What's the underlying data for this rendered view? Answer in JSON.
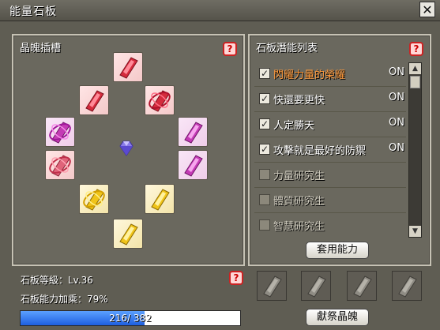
{
  "window": {
    "title": "能量石板",
    "close_label": "✕"
  },
  "crystal_panel": {
    "title": "晶魄插槽",
    "help_label": "?",
    "slots": [
      {
        "color": "red",
        "icon": "crystal-icon"
      },
      {
        "color": "red",
        "icon": "crystal-icon"
      },
      {
        "color": "red",
        "icon": "crystal-ring-icon"
      },
      {
        "color": "pink",
        "icon": "crystal-ring-icon"
      },
      {
        "color": "pink",
        "icon": "crystal-icon"
      },
      {
        "color": "red",
        "icon": "crystal-ring-icon"
      },
      {
        "color": "pink",
        "icon": "crystal-icon"
      },
      {
        "color": "yellow",
        "icon": "crystal-ring-icon"
      },
      {
        "color": "yellow",
        "icon": "crystal-icon"
      },
      {
        "color": "yellow",
        "icon": "crystal-icon"
      }
    ],
    "center_icon": "diamond-icon"
  },
  "ability_panel": {
    "title": "石板潛能列表",
    "help_label": "?",
    "items": [
      {
        "label": "閃耀力量的榮耀",
        "checked": true,
        "status": "ON",
        "highlight": true
      },
      {
        "label": "快還要更快",
        "checked": true,
        "status": "ON"
      },
      {
        "label": "人定勝天",
        "checked": true,
        "status": "ON"
      },
      {
        "label": "攻擊就是最好的防禦",
        "checked": true,
        "status": "ON"
      },
      {
        "label": "力量研究生",
        "checked": false,
        "status": ""
      },
      {
        "label": "體質研究生",
        "checked": false,
        "status": ""
      },
      {
        "label": "智慧研究生",
        "checked": false,
        "status": ""
      }
    ],
    "scroll_up": "▲",
    "scroll_down": "▼",
    "apply_button": "套用能力"
  },
  "stats": {
    "level_text": "石板等級：Lv.36",
    "bonus_text": "石板能力加乘：79%",
    "help_label": "?",
    "progress": {
      "current": 216,
      "max": 382,
      "text": "216/ 382"
    }
  },
  "offer_slots": [
    {
      "icon": "empty-crystal-icon"
    },
    {
      "icon": "empty-crystal-icon"
    },
    {
      "icon": "empty-crystal-icon"
    },
    {
      "icon": "empty-crystal-icon"
    }
  ],
  "offer_button": "獻祭晶魄",
  "colors": {
    "window_bg": "#5f5d53",
    "panel_bg": "#6a685e",
    "highlight_text": "#ff9a3c",
    "progress_fill": "#1e5fe0"
  }
}
